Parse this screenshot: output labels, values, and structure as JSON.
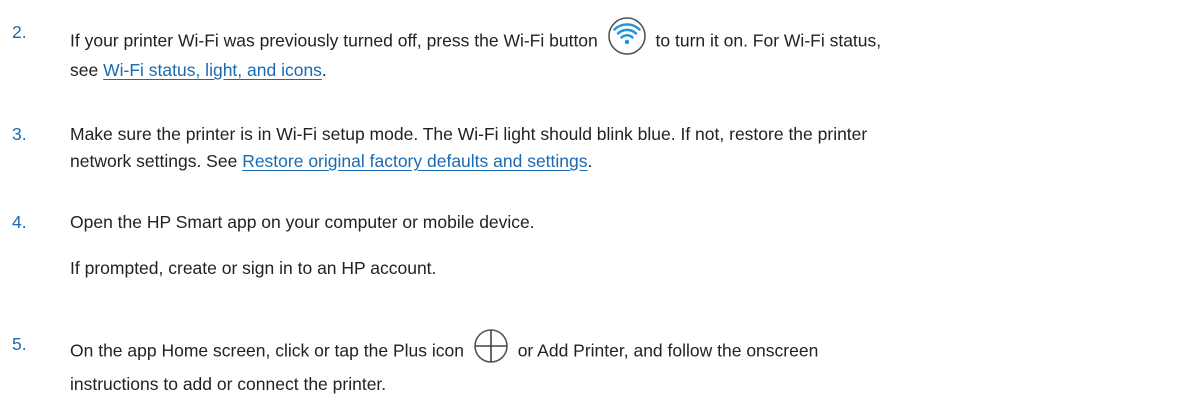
{
  "step2": {
    "number": "2.",
    "text_before_icon": "If your printer Wi-Fi was previously turned off, press the Wi-Fi button",
    "text_after_icon": "to turn it on. For Wi-Fi status,",
    "line2_prefix": "see",
    "link": "Wi-Fi status, light, and icons",
    "line2_suffix": ".",
    "icon": "wifi-button-icon"
  },
  "step3": {
    "number": "3.",
    "line1": "Make sure the printer is in Wi-Fi setup mode. The Wi-Fi light should blink blue. If not, restore the printer",
    "line2_prefix": "network settings. See",
    "link": "Restore original factory defaults and settings",
    "line2_suffix": "."
  },
  "step4": {
    "number": "4.",
    "line1": "Open the HP Smart app on your computer or mobile device.",
    "line2": "If prompted, create or sign in to an HP account."
  },
  "step5": {
    "number": "5.",
    "text_before_icon": "On the app Home screen, click or tap the Plus icon",
    "text_after_icon": "or Add Printer, and follow the onscreen",
    "line2": "instructions to add or connect the printer.",
    "icon": "plus-circle-icon"
  },
  "colors": {
    "accent": "#1a6ab2",
    "text": "#222222",
    "icon_border": "#555555"
  }
}
